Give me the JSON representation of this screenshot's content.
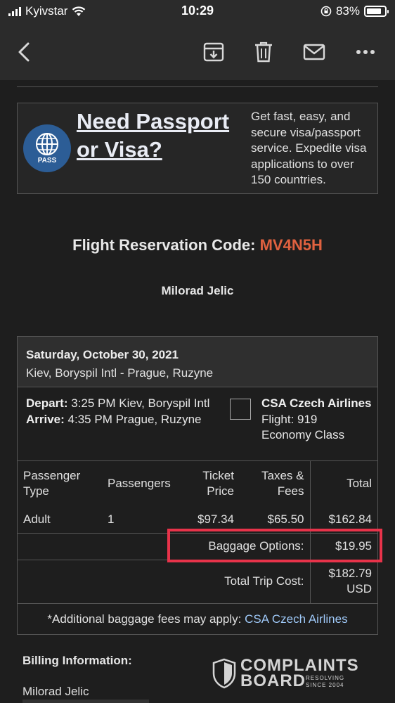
{
  "status_bar": {
    "carrier": "Kyivstar",
    "time": "10:29",
    "battery": "83%",
    "battery_level": 0.83
  },
  "toolbar": {
    "back": "chevron-left-icon",
    "archive": "archive-icon",
    "delete": "trash-icon",
    "mail": "mail-icon",
    "more": "more-icon"
  },
  "banner": {
    "badge": "PASS",
    "title": "Need Passport or Visa?",
    "text": "Get fast, easy, and secure visa/passport service. Expedite visa applications to over 150 countries."
  },
  "reservation": {
    "label": "Flight Reservation Code:",
    "code": "MV4N5H",
    "code_color": "#e0613f"
  },
  "passenger_name": "Milorad Jelic",
  "itinerary": {
    "date": "Saturday, October 30, 2021",
    "route": "Kiev, Boryspil Intl - Prague, Ruzyne",
    "depart_label": "Depart:",
    "depart": "3:25 PM Kiev, Boryspil Intl",
    "arrive_label": "Arrive:",
    "arrive": "4:35 PM Prague, Ruzyne",
    "airline": "CSA Czech Airlines",
    "flight": "Flight: 919",
    "class": "Economy Class"
  },
  "fare": {
    "headers": [
      "Passenger Type",
      "Passengers",
      "Ticket Price",
      "Taxes & Fees",
      "Total"
    ],
    "row": [
      "Adult",
      "1",
      "$97.34",
      "$65.50",
      "$162.84"
    ],
    "baggage_label": "Baggage Options:",
    "baggage_value": "$19.95",
    "total_label": "Total Trip Cost:",
    "total_value": "$182.79",
    "total_currency": "USD"
  },
  "note": {
    "text": "*Additional baggage fees may apply:",
    "link": "CSA Czech Airlines"
  },
  "billing": {
    "heading": "Billing Information:",
    "name": "Milorad Jelic"
  },
  "watermark": {
    "line1": "COMPLAINTS",
    "line2": "BOARD",
    "line3": "RESOLVING",
    "line4": "SINCE 2004"
  },
  "colors": {
    "highlight": "#e8334a",
    "link": "#9ec8f7",
    "background": "#1e1e1e"
  }
}
